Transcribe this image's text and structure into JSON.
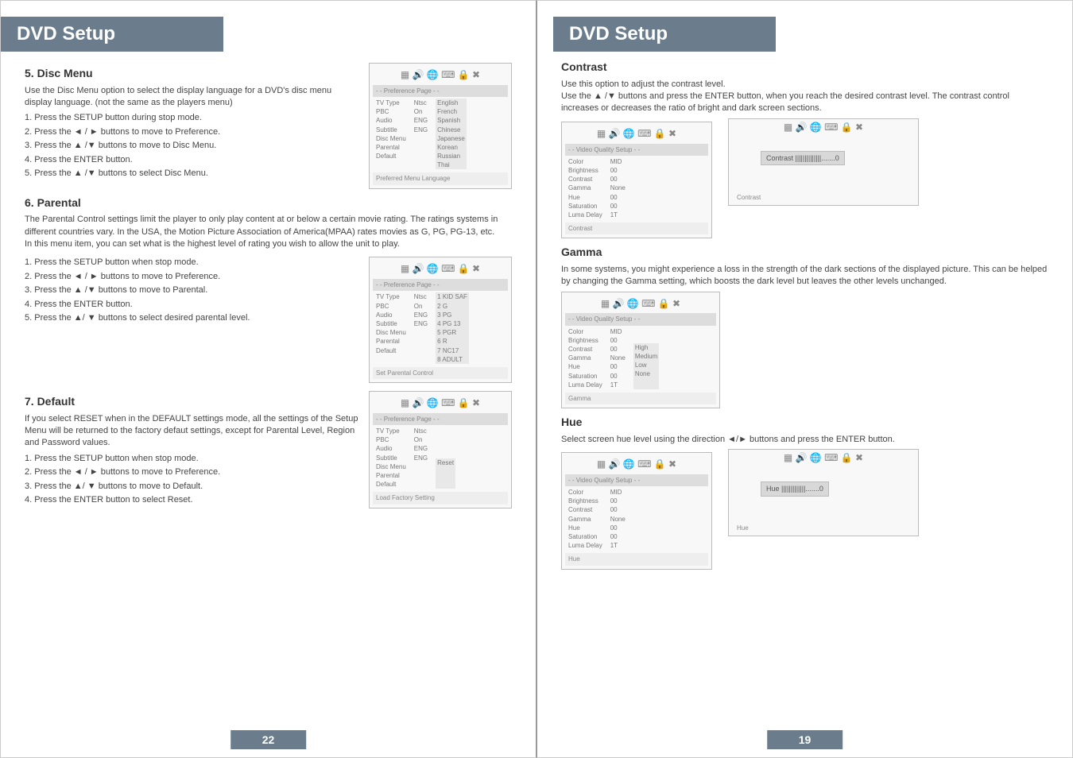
{
  "left": {
    "banner": "DVD Setup",
    "sec5_title": "5. Disc Menu",
    "sec5_desc": "Use the Disc Menu option to select the display language for a DVD's disc menu display language. (not the same as the players menu)",
    "sec5_steps": [
      "1. Press the SETUP button during stop mode.",
      "2. Press the ◄ / ► buttons to move to Preference.",
      "3. Press the ▲ /▼  buttons to move to Disc Menu.",
      "4. Press the ENTER button.",
      "5. Press the ▲ /▼  buttons to select Disc Menu."
    ],
    "sec6_title": "6. Parental",
    "sec6_desc1": "The Parental Control settings limit the player to only play content at or below a certain movie rating. The ratings systems in different countries vary. In the USA, the Motion Picture Association of America(MPAA) rates movies as G, PG, PG-13, etc.",
    "sec6_desc2": "In this menu item, you can set what is the highest level of rating you wish to allow the unit to play.",
    "sec6_steps": [
      "1. Press the SETUP button when stop mode.",
      "2. Press the ◄ / ► buttons to move to Preference.",
      "3. Press the ▲ /▼  buttons to move to Parental.",
      "4. Press the ENTER button.",
      "5. Press the  ▲/ ▼  buttons to select desired parental level."
    ],
    "sec7_title": "7. Default",
    "sec7_desc": "If you select RESET when in the DEFAULT settings mode, all the settings of the Setup Menu will be returned to the factory defaut settings, except for Parental Level, Region and Password values.",
    "sec7_steps": [
      "1. Press the SETUP button when stop mode.",
      "2. Press the ◄ / ► buttons to move to Preference.",
      "3. Press the  ▲/ ▼ buttons to move to Default.",
      "4. Press the ENTER button to select Reset."
    ],
    "osd1": {
      "title": "- - Preference Page - -",
      "left_items": [
        "TV Type",
        "PBC",
        "Audio",
        "Subtitle",
        "Disc Menu",
        "Parental",
        "Default"
      ],
      "mid_items": [
        "Ntsc",
        "On",
        "ENG",
        "",
        "ENG",
        "",
        ""
      ],
      "right_items": [
        "English",
        "French",
        "Spanish",
        "Chinese",
        "Japanese",
        "Korean",
        "Russian",
        "Thai"
      ],
      "footer": "Preferred Menu Language"
    },
    "osd2": {
      "title": "- - Preference Page - -",
      "left_items": [
        "TV Type",
        "PBC",
        "Audio",
        "Subtitle",
        "Disc Menu",
        "Parental",
        "Default"
      ],
      "mid_items": [
        "Ntsc",
        "On",
        "ENG",
        "",
        "ENG",
        "",
        ""
      ],
      "right_items": [
        "1 KID SAF",
        "2 G",
        "3 PG",
        "4 PG 13",
        "5 PGR",
        "6 R",
        "7 NC17",
        "8 ADULT"
      ],
      "footer": "Set Parental Control"
    },
    "osd3": {
      "title": "- - Preference Page - -",
      "left_items": [
        "TV Type",
        "PBC",
        "Audio",
        "Subtitle",
        "Disc Menu",
        "Parental",
        "Default"
      ],
      "mid_items": [
        "Ntsc",
        "On",
        "ENG",
        "",
        "ENG",
        "",
        ""
      ],
      "right_items": [
        "Reset"
      ],
      "footer": "Load Factory Setting"
    },
    "page_num": "22"
  },
  "right": {
    "banner": "DVD Setup",
    "contrast_title": "Contrast",
    "contrast_desc": "Use this option to adjust the contrast level.\nUse the ▲ /▼ buttons and press the ENTER button, when you reach the desired contrast level. The contrast control increases or decreases the ratio of bright and dark screen sections.",
    "vq_title": "- - Video Quality Setup - -",
    "vq_items": [
      "Color",
      "Brightness",
      "Contrast",
      "Gamma",
      "Hue",
      "Saturation",
      "Luma Delay"
    ],
    "vq_vals_contrast": [
      "MID",
      "00",
      "00",
      "None",
      "00",
      "00",
      "1T"
    ],
    "slider_contrast": "Contrast  ||||||||||||||.......0",
    "footer_contrast": "Contrast",
    "gamma_title": "Gamma",
    "gamma_desc": "In some systems, you might experience a loss in the strength of the dark sections of the displayed picture. This can be helped by changing the Gamma setting, which boosts the dark level but leaves the other levels unchanged.",
    "vq_vals_gamma": [
      "MID",
      "00",
      "00",
      "None",
      "00",
      "00",
      "1T"
    ],
    "gamma_options": [
      "High",
      "Medium",
      "Low",
      "None"
    ],
    "footer_gamma": "Gamma",
    "hue_title": "Hue",
    "hue_desc": "Select screen hue level using the direction ◄/► buttons and press the ENTER button.",
    "vq_vals_hue": [
      "MID",
      "00",
      "00",
      "None",
      "00",
      "00",
      "1T"
    ],
    "slider_hue": "Hue       |||||||||||||.......0",
    "footer_hue": "Hue",
    "page_num": "19"
  },
  "icons": "▦ 🔊 🌐 ⌨ 🔒 ✖"
}
